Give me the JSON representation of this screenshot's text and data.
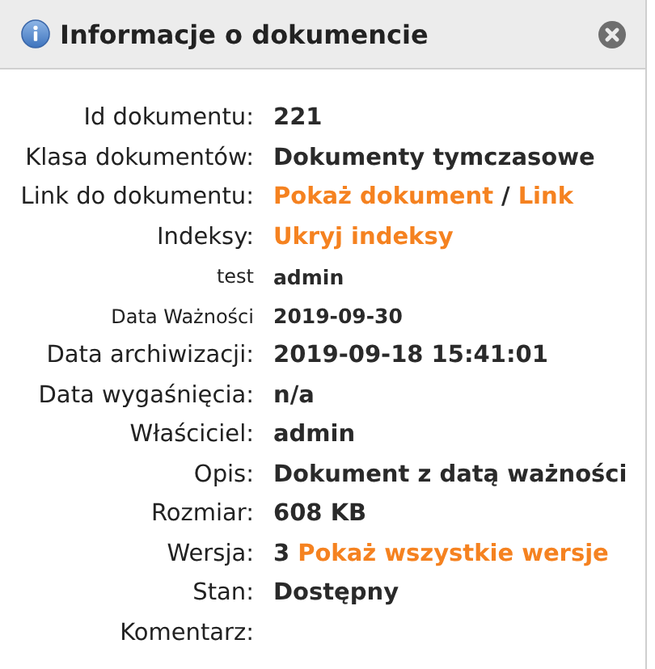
{
  "dialog": {
    "title": "Informacje o dokumencie"
  },
  "rows": [
    {
      "label": "Id dokumentu:",
      "kind": "standard",
      "value": [
        {
          "kind": "text",
          "text": "221"
        }
      ]
    },
    {
      "label": "Klasa dokumentów:",
      "kind": "standard",
      "value": [
        {
          "kind": "text",
          "text": "Dokumenty tymczasowe"
        }
      ]
    },
    {
      "label": "Link do dokumentu:",
      "kind": "standard",
      "value": [
        {
          "kind": "link",
          "text": "Pokaż dokument"
        },
        {
          "kind": "text",
          "text": "/"
        },
        {
          "kind": "link",
          "text": "Link"
        }
      ]
    },
    {
      "label": "Indeksy:",
      "kind": "standard",
      "value": [
        {
          "kind": "link",
          "text": "Ukryj indeksy"
        }
      ]
    },
    {
      "label": "test",
      "kind": "custom",
      "value": [
        {
          "kind": "text",
          "text": "admin"
        }
      ]
    },
    {
      "label": "Data Ważności",
      "kind": "custom",
      "value": [
        {
          "kind": "text",
          "text": "2019-09-30"
        }
      ]
    },
    {
      "label": "Data archiwizacji:",
      "kind": "standard",
      "value": [
        {
          "kind": "text",
          "text": "2019-09-18 15:41:01"
        }
      ]
    },
    {
      "label": "Data wygaśnięcia:",
      "kind": "standard",
      "value": [
        {
          "kind": "text",
          "text": "n/a"
        }
      ]
    },
    {
      "label": "Właściciel:",
      "kind": "standard",
      "value": [
        {
          "kind": "text",
          "text": "admin"
        }
      ]
    },
    {
      "label": "Opis:",
      "kind": "standard",
      "value": [
        {
          "kind": "text",
          "text": "Dokument z datą ważności"
        }
      ]
    },
    {
      "label": "Rozmiar:",
      "kind": "standard",
      "value": [
        {
          "kind": "text",
          "text": "608 KB"
        }
      ]
    },
    {
      "label": "Wersja:",
      "kind": "standard",
      "value": [
        {
          "kind": "text",
          "text": "3"
        },
        {
          "kind": "link",
          "text": "Pokaż wszystkie wersje"
        }
      ]
    },
    {
      "label": "Stan:",
      "kind": "standard",
      "value": [
        {
          "kind": "text",
          "text": "Dostępny"
        }
      ]
    },
    {
      "label": "Komentarz:",
      "kind": "standard",
      "value": []
    }
  ]
}
